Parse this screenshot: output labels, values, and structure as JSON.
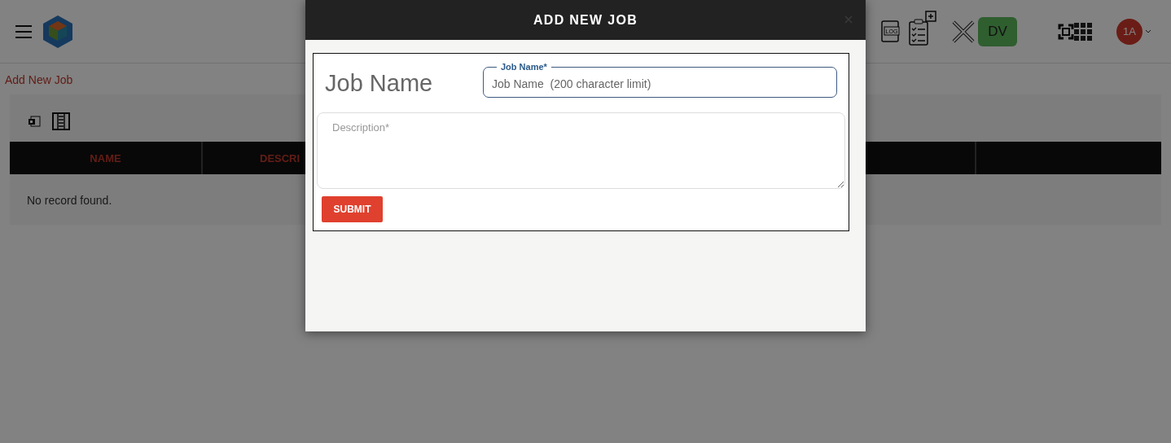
{
  "header": {
    "log_icon_label": "LOG",
    "user_badge": "DV",
    "avatar": "1A"
  },
  "breadcrumb": "Add New Job",
  "table": {
    "columns": [
      "NAME",
      "DESCRI"
    ],
    "empty_message": "No record found."
  },
  "modal": {
    "title": "ADD NEW JOB",
    "heading": "Job Name",
    "job_name_field": {
      "label": "Job Name*",
      "placeholder": "Job Name  (200 character limit)"
    },
    "description_field": {
      "placeholder": "Description*"
    },
    "submit": "SUBMIT"
  }
}
